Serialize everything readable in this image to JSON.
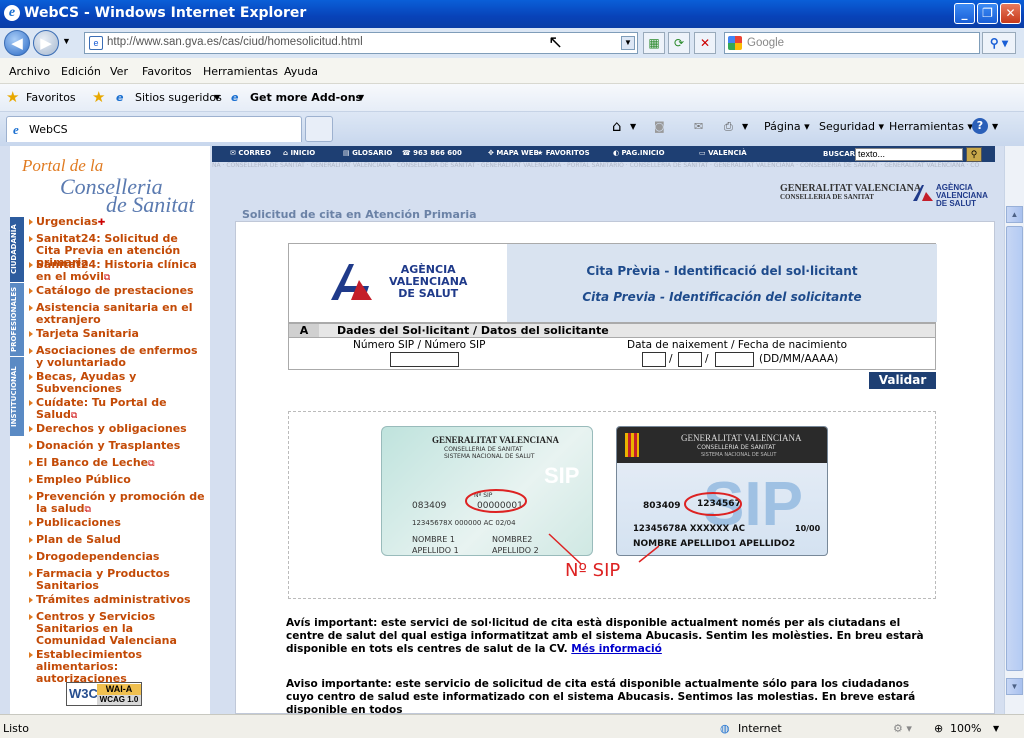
{
  "window": {
    "title": "WebCS - Windows Internet Explorer",
    "minimize": "_",
    "restore": "❐",
    "close": "✕"
  },
  "address": {
    "url": "http://www.san.gva.es/cas/ciud/homesolicitud.html",
    "search_placeholder": "Google"
  },
  "menu": [
    "Archivo",
    "Edición",
    "Ver",
    "Favoritos",
    "Herramientas",
    "Ayuda"
  ],
  "favorites_bar": {
    "favorites": "Favoritos",
    "suggested": "Sitios sugeridos",
    "addons": "Get more Add-ons"
  },
  "tab": {
    "title": "WebCS"
  },
  "commands": {
    "page": "Página",
    "security": "Seguridad",
    "tools": "Herramientas"
  },
  "site": {
    "logo_line1": "Portal de la",
    "logo_line2": "Conselleria",
    "logo_line3": "de Sanitat",
    "side_tabs": [
      "CIUDADANÍA",
      "PROFESIONALES",
      "INSTITUCIONAL"
    ],
    "top_nav": [
      "CORREO",
      "INICIO",
      "GLOSARIO",
      "963 866 600",
      "MAPA WEB",
      "FAVORITOS",
      "PAG.INICIO",
      "VALENCIÀ"
    ],
    "search_label": "BUSCAR",
    "search_value": "texto...",
    "ticker": "NA · CONSELLERIA DE SANITAT · GENERALITAT VALENCIANA · CONSELLERIA DE SANITAT · GENERALITAT VALENCIANA · PORTAL SANITARIO · CONSELLERIA DE SANITAT · GENERALITAT VALENCIANA · CONSELLERIA DE SANITAT · GENERALITAT VALENCIANA · CO",
    "gva_logo": {
      "line1": "GENERALITAT VALENCIANA",
      "line2": "CONSELLERIA DE SANITAT"
    },
    "avs_small": {
      "line1": "AGÈNCIA",
      "line2": "VALENCIANA",
      "line3": "DE SALUT"
    },
    "breadcrumb": "Solicitud de cita en Atención Primaria",
    "nav_items": [
      {
        "label": "Urgencias",
        "ext": "✚"
      },
      {
        "label": "Sanitat24: Solicitud de Cita Previa en atención primaria"
      },
      {
        "label": "Sanitat24: Historia clínica en el móvil",
        "ext": "⧉"
      },
      {
        "label": "Catálogo de prestaciones"
      },
      {
        "label": "Asistencia sanitaria en el extranjero"
      },
      {
        "label": "Tarjeta Sanitaria"
      },
      {
        "label": "Asociaciones de enfermos y voluntariado"
      },
      {
        "label": "Becas, Ayudas y Subvenciones"
      },
      {
        "label": "Cuídate: Tu Portal de Salud",
        "ext": "⧉"
      },
      {
        "label": "Derechos y obligaciones"
      },
      {
        "label": "Donación y Trasplantes"
      },
      {
        "label": "El Banco de Leche",
        "ext": "⧉"
      },
      {
        "label": "Empleo Público"
      },
      {
        "label": "Prevención y promoción de la salud",
        "ext": "⧉"
      },
      {
        "label": "Publicaciones"
      },
      {
        "label": "Plan de Salud"
      },
      {
        "label": "Drogodependencias"
      },
      {
        "label": "Farmacia y Productos Sanitarios"
      },
      {
        "label": "Trámites administrativos"
      },
      {
        "label": "Centros y Servicios Sanitarios en la Comunidad Valenciana"
      },
      {
        "label": "Establecimientos alimentarios: autorizaciones"
      }
    ],
    "w3c": {
      "logo": "W3C",
      "level": "WAI-A",
      "version": "WCAG 1.0"
    }
  },
  "form": {
    "agency": {
      "line1": "AGÈNCIA",
      "line2": "VALENCIANA",
      "line3": "DE SALUT"
    },
    "title_val": "Cita Prèvia - Identificació del sol·licitant",
    "title_es": "Cita Previa - Identificación del solicitante",
    "section_letter": "A",
    "section_title": "Dades del Sol·licitant / Datos del solicitante",
    "sip_label": "Número SIP / Número SIP",
    "birth_label": "Data de naixement / Fecha de nacimiento",
    "date_sep": "/",
    "date_format": "(DD/MM/AAAA)",
    "submit": "Validar"
  },
  "cards": {
    "card1": {
      "header": "GENERALITAT VALENCIANA",
      "sub1": "CONSELLERIA DE SANITAT",
      "sub2": "SISTEMA NACIONAL DE SALUT",
      "brand": "SIP",
      "num_label": "Nº SIP",
      "code": "083409",
      "sip": "00000001",
      "row2": "12345678X 000000    AC    02/04",
      "name1": "NOMBRE 1",
      "name2": "NOMBRE2",
      "ap1": "APELLIDO 1",
      "ap2": "APELLIDO 2"
    },
    "card2": {
      "header": "GENERALITAT VALENCIANA",
      "sub1": "CONSELLERIA DE SANITAT",
      "sub2": "SISTEMA NACIONAL DE SALUT",
      "brand": "SIP",
      "code": "803409",
      "sip": "1234567",
      "row2": "12345678A  XXXXXX    AC",
      "valid": "10/00",
      "name": "NOMBRE APELLIDO1 APELLIDO2"
    },
    "caption": "Nº SIP"
  },
  "notices": {
    "val": "Avís important: este servici de sol·licitud de cita està disponible actualment només per als ciutadans el centre de salut del qual estiga informatitzat amb el sistema Abucasis. Sentim les molèsties. En breu estarà disponible en tots els centres de salut de la CV.",
    "val_link": "Més informació",
    "es": "Aviso importante: este servicio de solicitud de cita está disponible actualmente sólo para los ciudadanos cuyo centro de salud este informatizado con el sistema Abucasis. Sentimos las molestias. En breve estará disponible en todos"
  },
  "status": {
    "text": "Listo",
    "zone": "Internet",
    "zoom": "100%"
  }
}
